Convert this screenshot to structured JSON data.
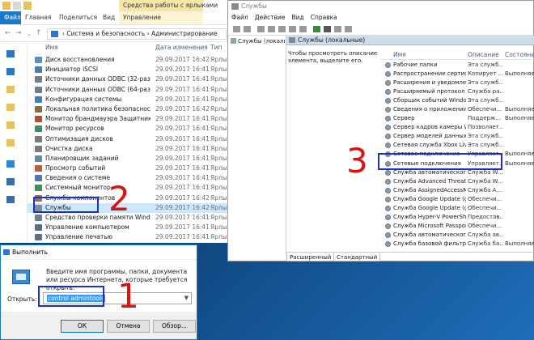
{
  "explorer": {
    "tabs": [
      "Файл",
      "Главная",
      "Поделиться",
      "Вид"
    ],
    "context_group": "Средства работы с ярлыками",
    "context_tab": "Управление",
    "breadcrumb": "›  Система и безопасность  ›  Администрирование",
    "columns": {
      "name": "Имя",
      "date": "Дата изменения",
      "type": "Тип"
    },
    "files": [
      {
        "name": "Диск восстановления",
        "date": "29.09.2017 16:42",
        "type": "Ярлык",
        "color": "#5b8ec9"
      },
      {
        "name": "Инициатор iSCSI",
        "date": "29.09.2017 16:41",
        "type": "Ярлык",
        "color": "#4c7ab3"
      },
      {
        "name": "Источники данных ODBC (32-разрядна...",
        "date": "29.09.2017 16:41",
        "type": "Ярлык",
        "color": "#6a7f95"
      },
      {
        "name": "Источники данных ODBC (64-разрядна...",
        "date": "29.09.2017 16:41",
        "type": "Ярлык",
        "color": "#6a7f95"
      },
      {
        "name": "Конфигурация системы",
        "date": "29.09.2017 16:41",
        "type": "Ярлык",
        "color": "#3f7fbf"
      },
      {
        "name": "Локальная политика безопасности",
        "date": "29.09.2017 16:42",
        "type": "Ярлык",
        "color": "#8a6d3b"
      },
      {
        "name": "Монитор брандмауэра Защитника Win...",
        "date": "29.09.2017 16:41",
        "type": "Ярлык",
        "color": "#b54a3a"
      },
      {
        "name": "Монитор ресурсов",
        "date": "29.09.2017 16:41",
        "type": "Ярлык",
        "color": "#3d8f5a"
      },
      {
        "name": "Оптимизация дисков",
        "date": "29.09.2017 16:41",
        "type": "Ярлык",
        "color": "#7b7b7b"
      },
      {
        "name": "Очистка диска",
        "date": "29.09.2017 16:41",
        "type": "Ярлык",
        "color": "#7b7b7b"
      },
      {
        "name": "Планировщик заданий",
        "date": "29.09.2017 16:41",
        "type": "Ярлык",
        "color": "#5f8f9f"
      },
      {
        "name": "Просмотр событий",
        "date": "29.09.2017 16:41",
        "type": "Ярлык",
        "color": "#c25d2e"
      },
      {
        "name": "Сведения о системе",
        "date": "29.09.2017 16:41",
        "type": "Ярлык",
        "color": "#4c7ab3"
      },
      {
        "name": "Системный монитор",
        "date": "29.09.2017 16:41",
        "type": "Ярлык",
        "color": "#3d8f5a"
      },
      {
        "name": "Службы компонентов",
        "date": "29.09.2017 16:42",
        "type": "Ярлык",
        "color": "#8a7a4a"
      },
      {
        "name": "Службы",
        "date": "29.09.2017 16:42",
        "type": "Ярлык",
        "color": "#7d8a97"
      },
      {
        "name": "Средство проверки памяти Windows",
        "date": "29.09.2017 16:41",
        "type": "Ярлык",
        "color": "#6a7f95"
      },
      {
        "name": "Управление компьютером",
        "date": "29.09.2017 16:41",
        "type": "Ярлык",
        "color": "#5b6f85"
      },
      {
        "name": "Управление печатью",
        "date": "29.09.2017 16:41",
        "type": "Ярлык",
        "color": "#5b6f85"
      }
    ]
  },
  "run": {
    "title": "Выполнить",
    "description": "Введите имя программы, папки, документа или ресурса Интернета, которые требуется открыть.",
    "open_label": "Открыть:",
    "value": "control admintools",
    "ok": "ОК",
    "cancel": "Отмена",
    "browse": "Обзор..."
  },
  "services": {
    "title": "Службы",
    "menu": [
      "Файл",
      "Действие",
      "Вид",
      "Справка"
    ],
    "tree_item": "Службы (локальные)",
    "header": "Службы (локальные)",
    "description": "Чтобы просмотреть описание элемента, выделите его.",
    "columns": {
      "name": "Имя",
      "description": "Описание",
      "status": "Состояние"
    },
    "rows": [
      {
        "name": "Рабочие папки",
        "desc": "Эта служб...",
        "status": ""
      },
      {
        "name": "Распространение сертифи...",
        "desc": "Копирует ...",
        "status": "Выполняется"
      },
      {
        "name": "Расширения и уведомлен...",
        "desc": "Эта служб...",
        "status": ""
      },
      {
        "name": "Расширяемый протокол п...",
        "desc": "Служба ра...",
        "status": ""
      },
      {
        "name": "Сборщик событий Windows",
        "desc": "Эта служб...",
        "status": ""
      },
      {
        "name": "Сведения о приложении",
        "desc": "Обеспечи...",
        "status": "Выполняется"
      },
      {
        "name": "Сервер",
        "desc": "Поддерж...",
        "status": "Выполняется"
      },
      {
        "name": "Сервер кадров камеры Wi...",
        "desc": "Позволяет...",
        "status": ""
      },
      {
        "name": "Сервер моделей данных п...",
        "desc": "Эта служб...",
        "status": ""
      },
      {
        "name": "Сетевая служба Xbox Live",
        "desc": "Эта служб...",
        "status": ""
      },
      {
        "name": "Сетевое подключение",
        "desc": "Управляет...",
        "status": "Выполняется"
      },
      {
        "name": "Сетевые подключения",
        "desc": "Управляет...",
        "status": "Выполняется"
      },
      {
        "name": "Служба автоматического о...",
        "desc": "Служба W...",
        "status": ""
      },
      {
        "name": "Служба Advanced Threat P...",
        "desc": "Служба W...",
        "status": ""
      },
      {
        "name": "Служба AssignedAccessMa...",
        "desc": "Служба A...",
        "status": ""
      },
      {
        "name": "Служба Google Update (gu...",
        "desc": "Обеспечи...",
        "status": ""
      },
      {
        "name": "Служба Google Update (gu...",
        "desc": "Обеспечи...",
        "status": ""
      },
      {
        "name": "Служба Hyper-V PowerShe...",
        "desc": "Предостав...",
        "status": ""
      },
      {
        "name": "Служба Microsoft Passport",
        "desc": "Обеспечи...",
        "status": ""
      },
      {
        "name": "Служба автоматического ...",
        "desc": "Служба ав...",
        "status": ""
      },
      {
        "name": "Служба базовой фильтрац...",
        "desc": "Служба ба...",
        "status": "Выполняется"
      }
    ],
    "tab_extended": "Расширенный",
    "tab_standard": "Стандартный"
  },
  "annotations": {
    "step1": "1",
    "step2": "2",
    "step3": "3",
    "highlight_color": "#1b2fcc",
    "number_color": "#dd1111"
  }
}
